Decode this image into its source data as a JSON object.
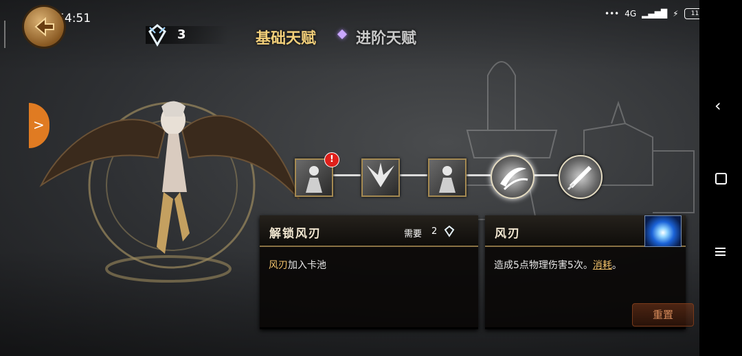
{
  "status_bar": {
    "time": "下午4:51",
    "network": "4G",
    "battery": "11"
  },
  "currency": {
    "value": "3",
    "icon": "talent-crystal-icon"
  },
  "tabs": {
    "basic": "基础天赋",
    "advanced": "进阶天赋"
  },
  "talent_tree": {
    "nodes": [
      {
        "id": "node-1",
        "icon": "character-portrait-icon",
        "alert": "!"
      },
      {
        "id": "node-2",
        "icon": "wing-burst-icon"
      },
      {
        "id": "node-3",
        "icon": "character-portrait-icon"
      },
      {
        "id": "node-4",
        "icon": "wind-blade-icon",
        "selected": true
      },
      {
        "id": "node-5",
        "icon": "sword-slash-icon"
      }
    ]
  },
  "unlock_panel": {
    "title": "解锁风刃",
    "requirement_label": "需要",
    "requirement_count": "2",
    "desc_keyword": "风刃",
    "desc_rest": "加入卡池"
  },
  "skill_panel": {
    "title": "风刃",
    "desc_main": "造成5点物理伤害5次。",
    "desc_keyword": "消耗",
    "desc_end": "。"
  },
  "reset_label": "重置",
  "colors": {
    "accent_gold": "#f2cf7a",
    "keyword": "#f2c26a",
    "alert": "#e0201b",
    "side_tab": "#e07b22"
  }
}
